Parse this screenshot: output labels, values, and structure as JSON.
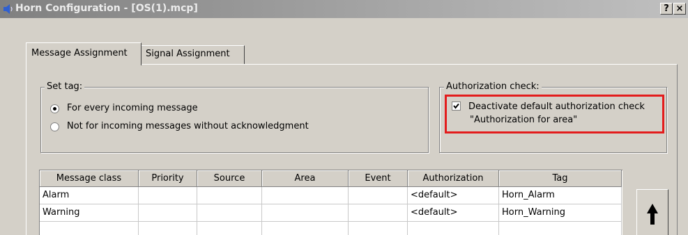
{
  "window": {
    "title": "Horn Configuration - [OS(1).mcp]",
    "help_label": "?",
    "close_label": "×"
  },
  "tabs": [
    {
      "label": "Message Assignment",
      "active": true
    },
    {
      "label": "Signal Assignment",
      "active": false
    }
  ],
  "set_tag": {
    "title": "Set tag:",
    "options": [
      {
        "label": "For every incoming message",
        "selected": true
      },
      {
        "label": "Not for incoming messages without acknowledgment",
        "selected": false
      }
    ]
  },
  "authorization_check": {
    "title": "Authorization check:",
    "checkbox_line1": "Deactivate default authorization check",
    "checkbox_line2": "\"Authorization for area\"",
    "checked": true,
    "highlight_color": "#e31c1c"
  },
  "table": {
    "columns": [
      "Message class",
      "Priority",
      "Source",
      "Area",
      "Event",
      "Authorization",
      "Tag"
    ],
    "rows": [
      [
        "Alarm",
        "",
        "",
        "",
        "",
        "<default>",
        "Horn_Alarm"
      ],
      [
        "Warning",
        "",
        "",
        "",
        "",
        "<default>",
        "Horn_Warning"
      ],
      [
        "",
        "",
        "",
        "",
        "",
        "",
        ""
      ]
    ]
  },
  "move_up_icon": "up-arrow-icon"
}
